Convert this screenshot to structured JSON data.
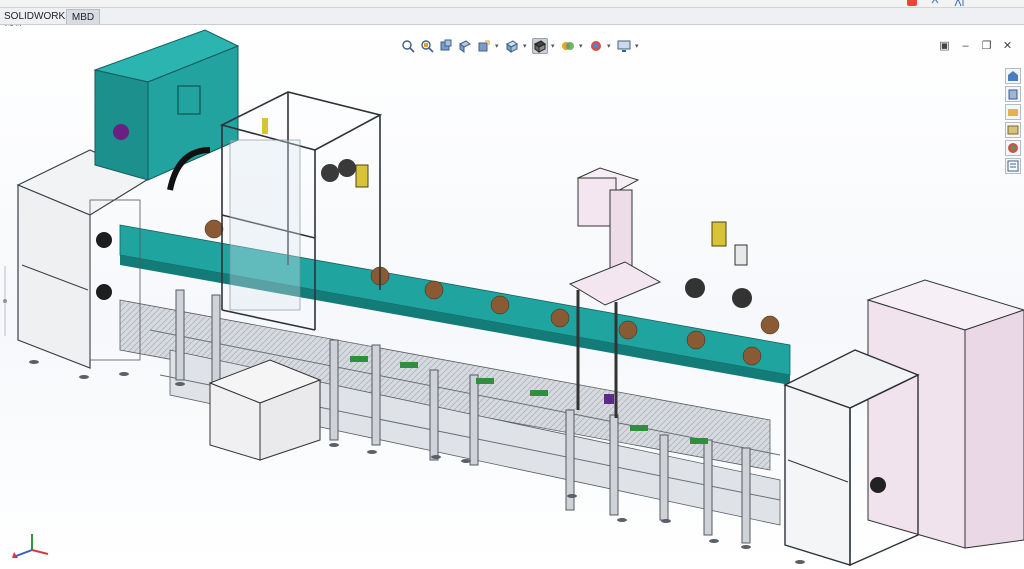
{
  "tabs": {
    "plugins_label": "SOLIDWORKS 插件",
    "mbd_label": "MBD"
  },
  "heads_up_toolbar": {
    "icons": [
      "zoom-to-fit-icon",
      "zoom-area-icon",
      "previous-view-icon",
      "section-view-icon",
      "dynamic-annotation-icon",
      "view-orientation-icon",
      "display-style-icon",
      "hide-show-items-icon",
      "edit-appearance-icon",
      "apply-scene-icon",
      "view-settings-icon"
    ]
  },
  "window_controls": {
    "icons": [
      "tile-icon",
      "minimize-icon",
      "restore-icon",
      "close-icon"
    ]
  },
  "task_pane": {
    "icons": [
      "solidworks-resources-icon",
      "design-library-icon",
      "file-explorer-icon",
      "view-palette-icon",
      "appearances-icon",
      "custom-properties-icon"
    ]
  },
  "colors": {
    "teal_panel": "#1d9e9a",
    "frame_gray": "#c4c9cf",
    "pink_housing": "#f3e6f0",
    "yellow_motor": "#d8c235",
    "green_pcb": "#2f8f3c",
    "brown_part": "#8a5a34"
  }
}
